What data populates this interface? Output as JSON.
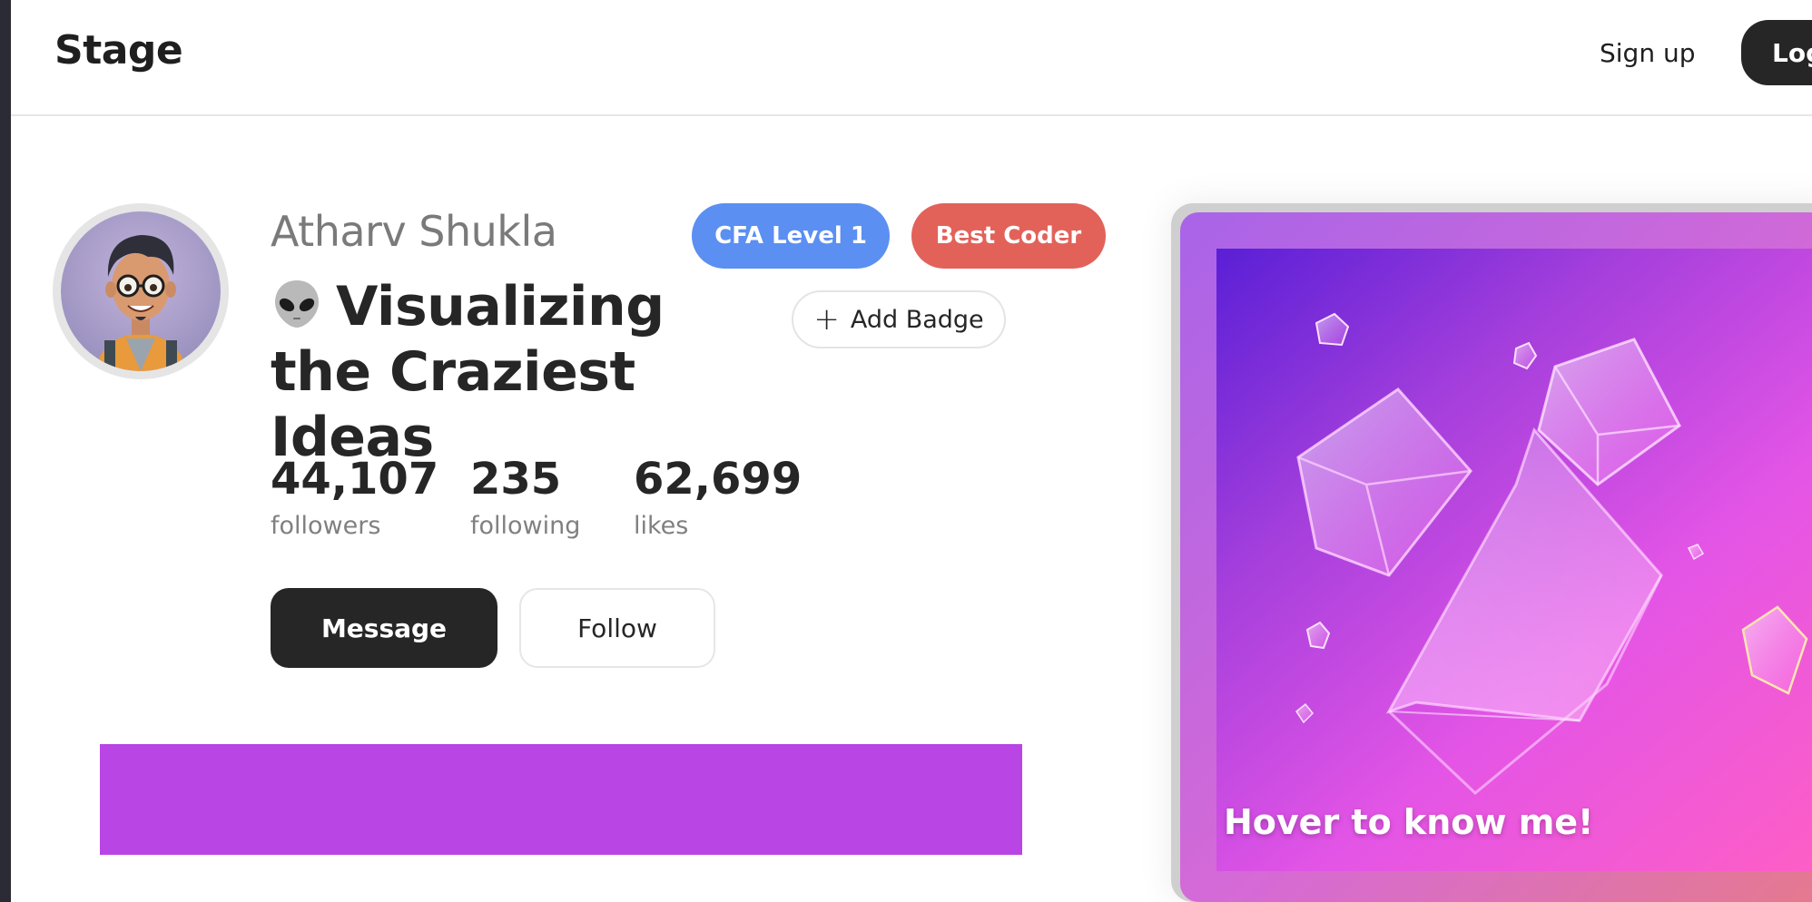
{
  "header": {
    "brand": "Stage",
    "signup_label": "Sign up",
    "login_label": "Log"
  },
  "profile": {
    "name": "Atharv Shukla",
    "headline": "Visualizing the Craziest Ideas",
    "headline_icon": "alien-emoji",
    "badges": [
      {
        "label": "CFA Level 1",
        "color": "#5b8ff1"
      },
      {
        "label": "Best Coder",
        "color": "#e2625a"
      }
    ],
    "add_badge_label": "Add Badge",
    "stats": {
      "followers": {
        "value": "44,107",
        "label": "followers"
      },
      "following": {
        "value": "235",
        "label": "following"
      },
      "likes": {
        "value": "62,699",
        "label": "likes"
      }
    },
    "message_label": "Message",
    "follow_label": "Follow"
  },
  "banner": {
    "color": "#b945e5"
  },
  "card": {
    "caption": "Hover to know me!"
  }
}
